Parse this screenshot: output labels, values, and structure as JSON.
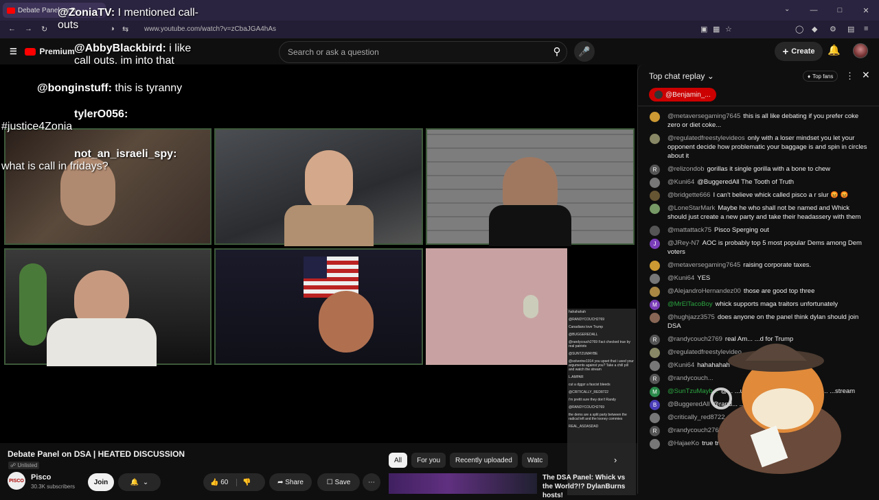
{
  "browser": {
    "tab_title": "Debate Panel on D...",
    "url": "www.youtube.com/watch?v=zCbaJGA4hAs"
  },
  "youtube": {
    "logo": "Premium",
    "search_placeholder": "Search or ask a question",
    "create_label": "Create"
  },
  "overlay_chat": [
    {
      "user": "@ZoniaTV:",
      "text": "I mentioned call-outs"
    },
    {
      "user": "@AbbyBlackbird:",
      "text": "i like call outs. im into that"
    },
    {
      "user": "@bonginstuff:",
      "text": "this is tyranny"
    },
    {
      "user": "tylerO056:",
      "text": "#justice4Zonia"
    },
    {
      "user": "not_an_israeli_spy:",
      "text": "what is call in fridays?"
    }
  ],
  "mini_chat": [
    "hahahahah",
    "@RANDYCOUCH2769",
    "Canadians love Trump",
    "@BUGGEREDALL",
    "@randycouch2769 Fact checked true by real patriots",
    "@SUNTZUMAYBE",
    "@solverine1914 you upset that i used your arguments against you? Take a chill pill and watch the stream",
    "L.AMPAR",
    "cut a dggzr a fascist bleeds",
    "@CRITICALLY_RED8722",
    "i'm prettt sure they don't Randy",
    "@RANDYCOUCH2769",
    "the dems are a split party between the radical left and the looney commies",
    "REAL_ASDASDAD"
  ],
  "video_info": {
    "title": "Debate Panel on DSA | HEATED DISCUSSION",
    "visibility": "Unlisted",
    "channel": "Pisco",
    "channel_avatar_text": "PISCO",
    "subscribers": "30.3K subscribers",
    "join_label": "Join",
    "likes": "60",
    "share_label": "Share",
    "save_label": "Save"
  },
  "chips": [
    "All",
    "For you",
    "Recently uploaded",
    "Watc"
  ],
  "recommended": {
    "title": "The DSA Panel: Whick vs the World?!? DylanBurns hosts!"
  },
  "chat": {
    "header": "Top chat replay",
    "top_fans_label": "Top fans",
    "pinned_user": "@Benjamin_...",
    "messages": [
      {
        "user": "@metaversegaming7645",
        "text": "this is all like debating if you prefer coke zero or diet coke...",
        "initial": "",
        "color": "#c93"
      },
      {
        "user": "@regulatedfreestylevideos",
        "text": "only with a loser mindset you let your opponent decide how problematic your baggage is and spin in circles about it",
        "initial": "",
        "color": "#886"
      },
      {
        "user": "@relizondob",
        "text": "gorillas it single gorilla with a bone to chew",
        "initial": "R",
        "color": "#555"
      },
      {
        "user": "@Kuni64",
        "text": "@BuggeredAll The Tooth of Truth",
        "initial": "",
        "color": "#777"
      },
      {
        "user": "@bridgette666",
        "text": "I can't believe whick called pisco a r slur 😡 😡",
        "initial": "",
        "color": "#653"
      },
      {
        "user": "@LoneStarMark",
        "text": "Maybe he who shall not be named and Whick should just create a new party and take their headassery with them",
        "initial": "",
        "color": "#796"
      },
      {
        "user": "@mattattack75",
        "text": "Pisco Sperging out",
        "initial": "",
        "color": "#555"
      },
      {
        "user": "@JRey-N7",
        "text": "AOC is probably top 5 most popular Dems among Dem voters",
        "initial": "J",
        "color": "#7a3db8"
      },
      {
        "user": "@metaversegaming7645",
        "text": "raising corporate taxes.",
        "initial": "",
        "color": "#c93"
      },
      {
        "user": "@Kuni64",
        "text": "YES",
        "initial": "",
        "color": "#777"
      },
      {
        "user": "@AlejandroHernandez00",
        "text": "those are good top three",
        "initial": "",
        "color": "#a84"
      },
      {
        "user": "@MrElTacoBoy",
        "text": "whick supports maga traitors unfortunately",
        "initial": "M",
        "color": "#7a3db8"
      },
      {
        "user": "@hughjazz3575",
        "text": "does anyone on the panel think dylan should join DSA",
        "initial": "",
        "color": "#865"
      },
      {
        "user": "@randycouch2769",
        "text": "real Am...  ...d for Trump",
        "initial": "R",
        "color": "#555"
      },
      {
        "user": "@regulatedfreestylevideo",
        "text": "",
        "initial": "",
        "color": "#886"
      },
      {
        "user": "@Kuni64",
        "text": "hahahahah",
        "initial": "",
        "color": "#777"
      },
      {
        "user": "@randycouch...",
        "text": "",
        "initial": "R",
        "color": "#555"
      },
      {
        "user": "@SunTzuMayb...",
        "text": "@...  ...used your arguments agains...  ...stream",
        "initial": "M",
        "color": "#2a8a4a"
      },
      {
        "user": "@BuggeredAll",
        "text": "@rand...  ...real patriots",
        "initial": "B",
        "color": "#4a3db8"
      },
      {
        "user": "@critically_red8722",
        "text": "",
        "initial": "",
        "color": "#777"
      },
      {
        "user": "@randycouch2769",
        "text": "...dical left and the looney comm...",
        "initial": "R",
        "color": "#555"
      },
      {
        "user": "@HajaeKo",
        "text": "true true true true true",
        "initial": "",
        "color": "#777"
      }
    ]
  }
}
